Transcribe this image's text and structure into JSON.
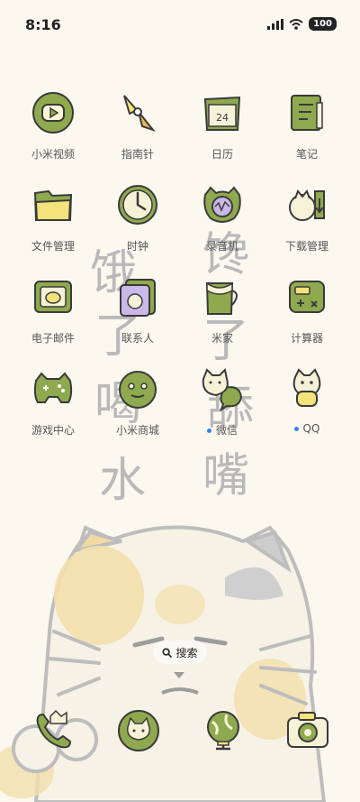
{
  "status_bar": {
    "time": "8:16",
    "battery": "100"
  },
  "wallpaper_text": [
    "饿",
    "馋",
    "了",
    "了",
    "喝",
    "舔",
    "水",
    "嘴"
  ],
  "apps": [
    {
      "label": "小米视频",
      "icon": "video-icon",
      "badge": false
    },
    {
      "label": "指南针",
      "icon": "compass-icon",
      "badge": false
    },
    {
      "label": "日历",
      "icon": "calendar-icon",
      "badge": false,
      "date": "24"
    },
    {
      "label": "笔记",
      "icon": "notes-icon",
      "badge": false
    },
    {
      "label": "文件管理",
      "icon": "folder-icon",
      "badge": false
    },
    {
      "label": "时钟",
      "icon": "clock-icon",
      "badge": false
    },
    {
      "label": "录音机",
      "icon": "recorder-icon",
      "badge": false
    },
    {
      "label": "下载管理",
      "icon": "download-icon",
      "badge": false
    },
    {
      "label": "电子邮件",
      "icon": "mail-icon",
      "badge": false
    },
    {
      "label": "联系人",
      "icon": "contacts-icon",
      "badge": false
    },
    {
      "label": "米家",
      "icon": "mijia-icon",
      "badge": false
    },
    {
      "label": "计算器",
      "icon": "calculator-icon",
      "badge": false
    },
    {
      "label": "游戏中心",
      "icon": "gamepad-icon",
      "badge": false
    },
    {
      "label": "小米商城",
      "icon": "store-icon",
      "badge": false
    },
    {
      "label": "微信",
      "icon": "wechat-icon",
      "badge": true
    },
    {
      "label": "QQ",
      "icon": "qq-icon",
      "badge": true
    }
  ],
  "search": {
    "label": "搜索"
  },
  "dock": [
    {
      "icon": "phone-icon"
    },
    {
      "icon": "messages-icon"
    },
    {
      "icon": "browser-icon"
    },
    {
      "icon": "camera-icon"
    }
  ],
  "colors": {
    "background": "#fbf8ef",
    "icon_green": "#8fa94e",
    "icon_yellow": "#f4e27a",
    "badge_blue": "#3f7ef5"
  }
}
